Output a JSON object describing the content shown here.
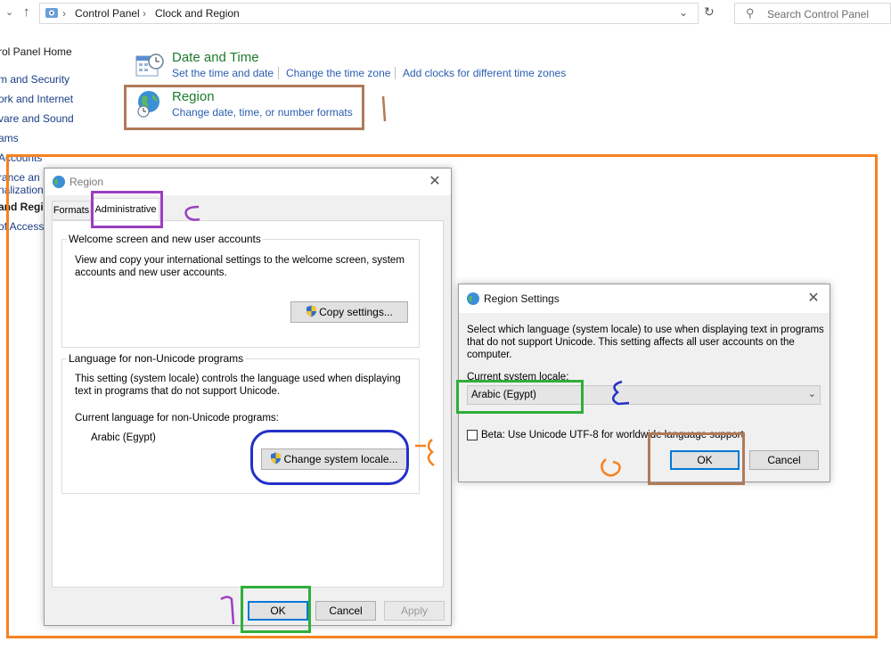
{
  "address_bar": {
    "breadcrumb": [
      "Control Panel",
      "Clock and Region"
    ],
    "search_placeholder": "Search Control Panel"
  },
  "sidebar": {
    "items": [
      "rol Panel Home",
      "m and Security",
      "ork and Internet",
      "vare and Sound",
      "ams",
      "Accounts",
      "rance an",
      "nalization",
      "and Regi",
      "of Access"
    ]
  },
  "categories": [
    {
      "title": "Date and Time",
      "links": [
        "Set the time and date",
        "Change the time zone",
        "Add clocks for different time zones"
      ]
    },
    {
      "title": "Region",
      "links": [
        "Change date, time, or number formats"
      ]
    }
  ],
  "region_dialog": {
    "title": "Region",
    "tabs": [
      "Formats",
      "Administrative"
    ],
    "welcome_group": {
      "legend": "Welcome screen and new user accounts",
      "description_line1": "View and copy your international settings to the welcome screen, system",
      "description_line2": "accounts and new user accounts.",
      "button": "Copy settings..."
    },
    "unicode_group": {
      "legend": "Language for non-Unicode programs",
      "description_line1": "This setting (system locale) controls the language used when displaying",
      "description_line2": "text in programs that do not support Unicode.",
      "current_label": "Current language for non-Unicode programs:",
      "current_value": "Arabic (Egypt)",
      "button": "Change system locale..."
    },
    "ok": "OK",
    "cancel": "Cancel",
    "apply": "Apply"
  },
  "region_settings_dialog": {
    "title": "Region Settings",
    "description_line1": "Select which language (system locale) to use when displaying text in programs",
    "description_line2": "that do not support Unicode. This setting affects all user accounts on the",
    "description_line3": "computer.",
    "current_label": "Current system locale:",
    "current_value": "Arabic (Egypt)",
    "beta_label": "Beta: Use Unicode UTF-8 for worldwide language support",
    "beta_checked": false,
    "ok": "OK",
    "cancel": "Cancel"
  },
  "annotations": {
    "colors": {
      "orange": "#f58220",
      "brown": "#b07a57",
      "purple": "#9b3fbf",
      "blue": "#2330c8",
      "green": "#2fae3a"
    }
  }
}
